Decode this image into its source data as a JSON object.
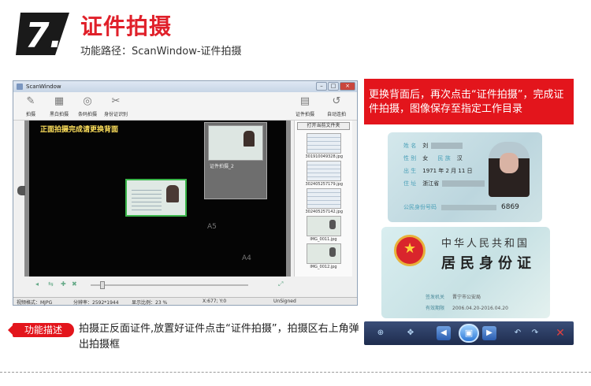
{
  "header": {
    "step_number": "7.",
    "title": "证件拍摄",
    "path": "功能路径：ScanWindow-证件拍摄"
  },
  "window": {
    "title": "ScanWindow",
    "controls": [
      "–",
      "□",
      "×"
    ],
    "toolbar": [
      {
        "label": "拍摄",
        "icon": "shutter-icon"
      },
      {
        "label": "黑白拍摄",
        "icon": "bw-camera-icon"
      },
      {
        "label": "条码拍摄",
        "icon": "barcode-camera-icon"
      },
      {
        "label": "身份证识别",
        "icon": "id-recognize-icon"
      },
      {
        "label": "证件拍摄",
        "icon": "id-capture-icon"
      },
      {
        "label": "自动连拍",
        "icon": "auto-burst-icon"
      }
    ],
    "viewer_message": "正面拍摄完成请更换背面",
    "popup_caption": "证件拍摄_2",
    "viewer_marks": [
      "A5",
      "A4"
    ],
    "open_folder_button": "打开当前文件夹",
    "thumbnails": [
      {
        "name": "301910049328.jpg"
      },
      {
        "name": "302405257179.jpg"
      },
      {
        "name": "302405257142.jpg"
      },
      {
        "name": "IMG_0011.jpg"
      },
      {
        "name": "IMG_0012.jpg"
      }
    ],
    "status": {
      "format": "视频格式：MJPG",
      "resolution": "分辨率：2592*1944",
      "zoom": "显示比例：23 %",
      "coords": "X:677; Y:0",
      "sign": "UnSigned"
    }
  },
  "right_panel": {
    "banner": "更换背面后，再次点击“证件拍摄”，完成证件拍摄，图像保存至指定工作目录",
    "front": {
      "name_label": "姓 名",
      "name_value": "刘",
      "sex_label": "性 别",
      "sex_value": "女",
      "nation_label": "民 族",
      "nation_value": "汉",
      "birth_label": "出 生",
      "birth_value": "1971 年 2 月 11 日",
      "addr_label": "住 址",
      "addr_value": "浙江省",
      "id_label": "公民身份号码",
      "id_tail": "6869"
    },
    "back": {
      "country": "中华人民共和国",
      "card": "居民身份证",
      "authority_label": "签发机关",
      "authority_value": "晋宁市公安局",
      "valid_label": "有效期限",
      "valid_value": "2006.04.20-2016.04.20"
    }
  },
  "function": {
    "label": "功能描述",
    "description": "拍摄正反面证件,放置好证件点击“证件拍摄”，拍摄区右上角弹出拍摄框"
  },
  "colors": {
    "accent_red": "#e3151c",
    "frame_green": "#3ab54a",
    "message_yellow": "#ffe15c"
  }
}
